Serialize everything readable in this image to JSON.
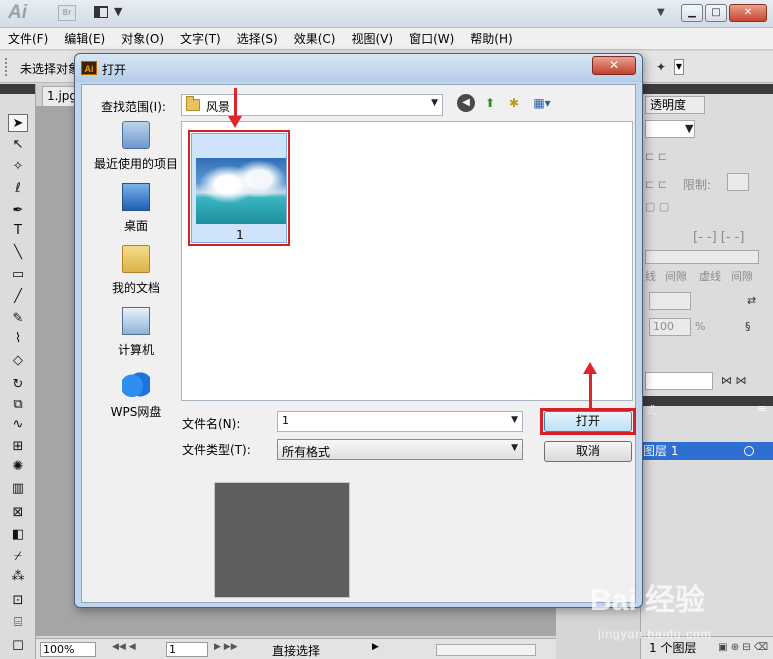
{
  "app": {
    "logo": "Ai",
    "bridge_badge": "Br",
    "menu": [
      "文件(F)",
      "编辑(E)",
      "对象(O)",
      "文字(T)",
      "选择(S)",
      "效果(C)",
      "视图(V)",
      "窗口(W)",
      "帮助(H)"
    ],
    "control_bar_label": "未选择对象",
    "doc_tab": "1.jpg",
    "status": {
      "zoom": "100%",
      "page": "1",
      "tool": "直接选择"
    },
    "panel": {
      "tab": "透明度",
      "limit_label": "限制:",
      "opacity_value": "100",
      "percent": "%",
      "dash_labels": [
        "线",
        "间隙",
        "虚线",
        "间隙"
      ]
    },
    "layers": {
      "layer_name": "图层 1",
      "count": "1 个图层",
      "tab_stub": "式"
    }
  },
  "dialog": {
    "title": "打开",
    "close_glyph": "✕",
    "look_in_label": "查找范围(I):",
    "look_in_value": "风景",
    "places": [
      {
        "label": "最近使用的项目",
        "icon": "recent-items-icon"
      },
      {
        "label": "桌面",
        "icon": "desktop-icon"
      },
      {
        "label": "我的文档",
        "icon": "my-documents-icon"
      },
      {
        "label": "计算机",
        "icon": "computer-icon"
      },
      {
        "label": "WPS网盘",
        "icon": "wps-cloud-icon"
      }
    ],
    "files": [
      {
        "name": "1",
        "type": "image-thumbnail"
      }
    ],
    "filename_label": "文件名(N):",
    "filename_value": "1",
    "filetype_label": "文件类型(T):",
    "filetype_value": "所有格式",
    "open_button": "打开",
    "cancel_button": "取消"
  },
  "watermark": {
    "main": "Bai 经验",
    "sub": "jingyan.baidu.com"
  },
  "colors": {
    "highlight_red": "#d81f26",
    "dialog_frame": "#c3d5ea",
    "layer_selected": "#2f6fd1"
  }
}
